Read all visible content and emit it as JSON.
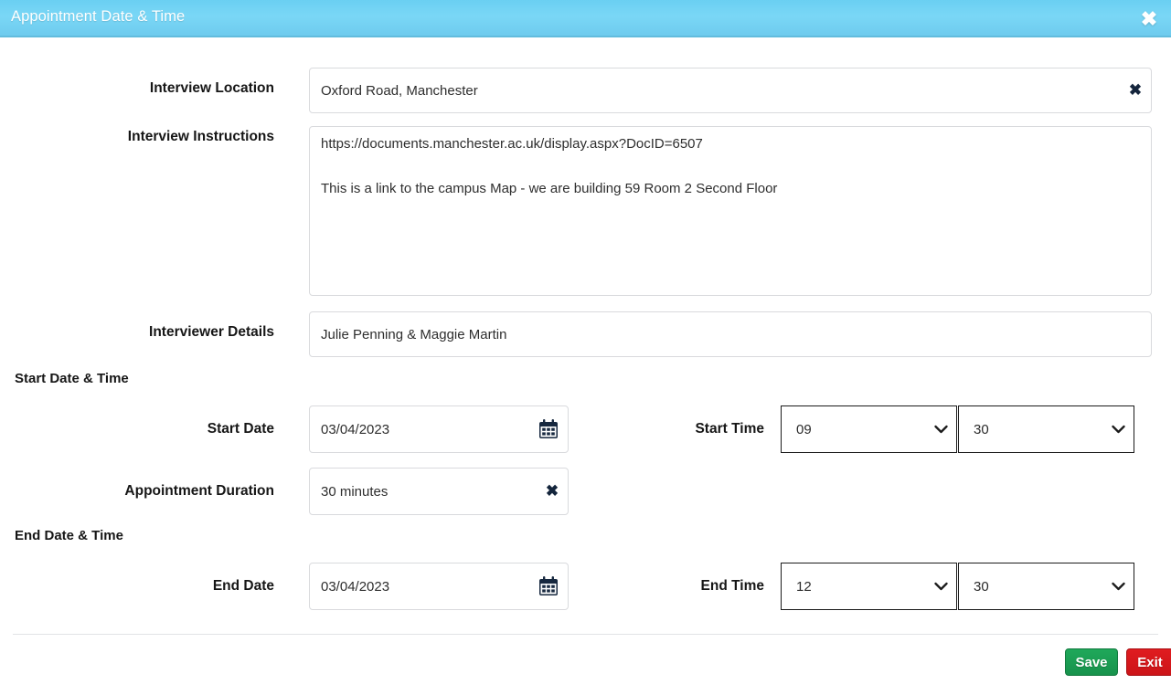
{
  "titlebar": {
    "title": "Appointment Date & Time",
    "close_label": "✖",
    "bg_color": "#6ed2f5"
  },
  "form": {
    "location": {
      "label": "Interview Location",
      "value": "Oxford Road, Manchester",
      "clear_label": "✖"
    },
    "instructions": {
      "label": "Interview Instructions",
      "line1": "https://documents.manchester.ac.uk/display.aspx?DocID=6507",
      "line2": "This is a link to the campus Map - we are building 59 Room 2 Second Floor"
    },
    "interviewer": {
      "label": "Interviewer Details",
      "value": "Julie Penning & Maggie Martin"
    },
    "start_section": {
      "heading": "Start Date & Time",
      "date_label": "Start Date",
      "date_value": "03/04/2023",
      "time_label": "Start Time",
      "hour_value": "09",
      "minute_value": "30"
    },
    "duration": {
      "label": "Appointment Duration",
      "value": "30 minutes",
      "clear_label": "✖"
    },
    "end_section": {
      "heading": "End Date & Time",
      "date_label": "End Date",
      "date_value": "03/04/2023",
      "time_label": "End Time",
      "hour_value": "12",
      "minute_value": "30"
    }
  },
  "footer": {
    "save_label": "Save",
    "exit_label": "Exit",
    "save_color": "#17924c",
    "exit_color": "#cc1418"
  }
}
